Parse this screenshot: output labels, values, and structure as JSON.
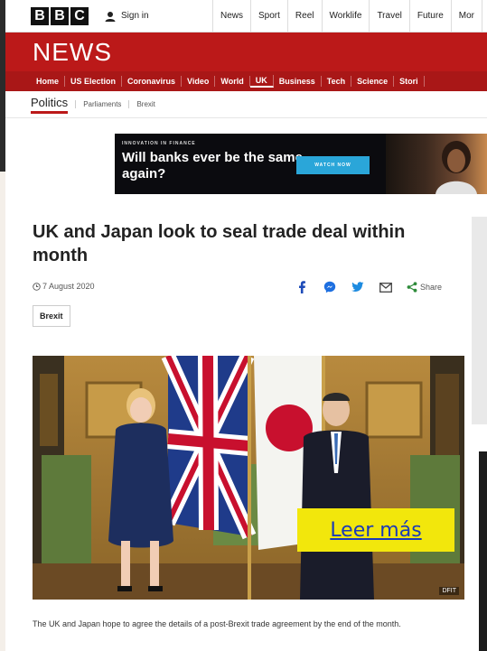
{
  "topbar": {
    "logo_letters": [
      "B",
      "B",
      "C"
    ],
    "signin_label": "Sign in",
    "nav": [
      "News",
      "Sport",
      "Reel",
      "Worklife",
      "Travel",
      "Future",
      "Mor"
    ]
  },
  "banner": {
    "title": "NEWS"
  },
  "rednav": {
    "items": [
      "Home",
      "US Election",
      "Coronavirus",
      "Video",
      "World",
      "UK",
      "Business",
      "Tech",
      "Science",
      "Stori"
    ],
    "active": "UK"
  },
  "subnav": {
    "main": "Politics",
    "items": [
      "Parliaments",
      "Brexit"
    ]
  },
  "ad": {
    "kicker": "INNOVATION IN FINANCE",
    "headline": "Will banks ever be the same again?",
    "button": "WATCH NOW"
  },
  "article": {
    "headline": "UK and Japan look to seal trade deal within month",
    "date": "7 August 2020",
    "share_label": "Share",
    "tag": "Brexit",
    "photo_credit": "DFIT",
    "read_more": "Leer más",
    "caption": "The UK and Japan hope to agree the details of a post-Brexit trade agreement by the end of the month."
  },
  "colors": {
    "brand_red": "#bb1919",
    "nav_red": "#a91717",
    "read_more_bg": "#f2e70c",
    "read_more_text": "#1a3ab8"
  },
  "icons": [
    "user-icon",
    "clock-icon",
    "facebook-icon",
    "messenger-icon",
    "twitter-icon",
    "email-icon",
    "share-icon"
  ]
}
